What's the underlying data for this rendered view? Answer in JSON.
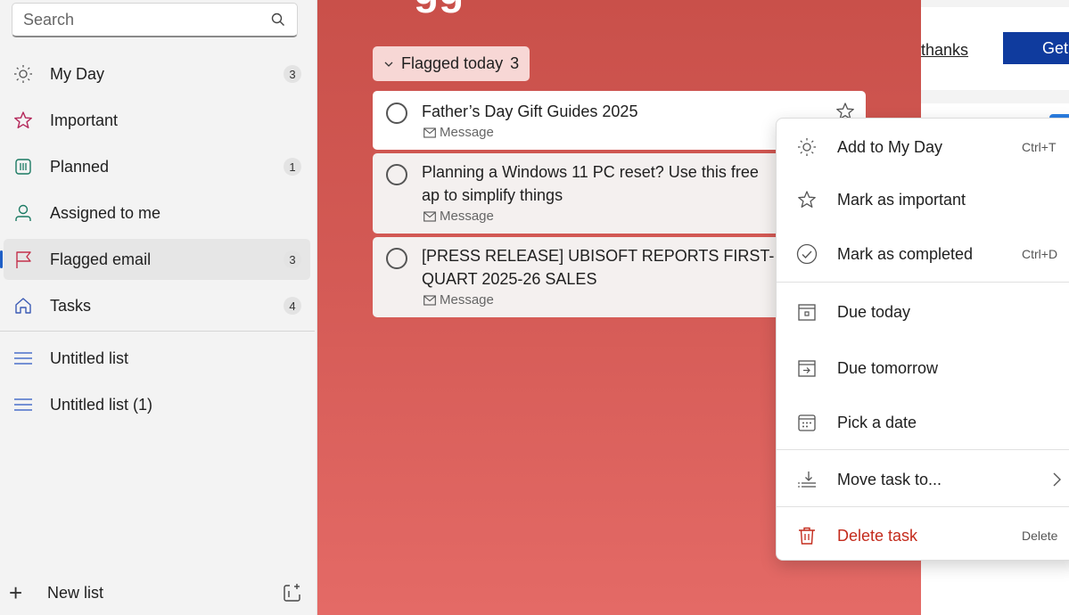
{
  "search": {
    "placeholder": "Search"
  },
  "sidebar": {
    "items": [
      {
        "label": "My Day",
        "count": "3",
        "icon": "sun-icon"
      },
      {
        "label": "Important",
        "count": "",
        "icon": "star-icon"
      },
      {
        "label": "Planned",
        "count": "1",
        "icon": "calendar-grid-icon"
      },
      {
        "label": "Assigned to me",
        "count": "",
        "icon": "person-icon"
      },
      {
        "label": "Flagged email",
        "count": "3",
        "icon": "flag-icon"
      },
      {
        "label": "Tasks",
        "count": "4",
        "icon": "home-icon"
      }
    ],
    "lists": [
      {
        "label": "Untitled list",
        "icon": "list-icon"
      },
      {
        "label": "Untitled list (1)",
        "icon": "list-icon"
      }
    ],
    "new_list_label": "New list",
    "accent": "#1f5fc6"
  },
  "main": {
    "title_fragment": "gg",
    "group": {
      "label": "Flagged today",
      "count": "3"
    },
    "tasks": [
      {
        "title": "Father’s Day Gift Guides 2025",
        "meta": "Message"
      },
      {
        "title": "Planning a Windows 11 PC reset? Use this free ap to simplify things",
        "meta": "Message"
      },
      {
        "title": "[PRESS RELEASE] UBISOFT REPORTS FIRST-QUART 2025-26 SALES",
        "meta": "Message"
      }
    ],
    "theme_color": "#d45a55"
  },
  "right_panel": {
    "thanks_link": "thanks",
    "get_button": "Get"
  },
  "context_menu": {
    "items": [
      {
        "label": "Add to My Day",
        "shortcut": "Ctrl+T",
        "icon": "sun-icon"
      },
      {
        "label": "Mark as important",
        "shortcut": "",
        "icon": "star-icon"
      },
      {
        "label": "Mark as completed",
        "shortcut": "Ctrl+D",
        "icon": "check-circle-icon"
      },
      {
        "label": "Due today",
        "shortcut": "",
        "icon": "calendar-today-icon"
      },
      {
        "label": "Due tomorrow",
        "shortcut": "",
        "icon": "calendar-arrow-icon"
      },
      {
        "label": "Pick a date",
        "shortcut": "",
        "icon": "calendar-pick-icon"
      },
      {
        "label": "Move task to...",
        "shortcut": "",
        "icon": "move-icon"
      },
      {
        "label": "Delete task",
        "shortcut": "Delete",
        "icon": "trash-icon"
      }
    ],
    "danger_color": "#c42b1c"
  }
}
